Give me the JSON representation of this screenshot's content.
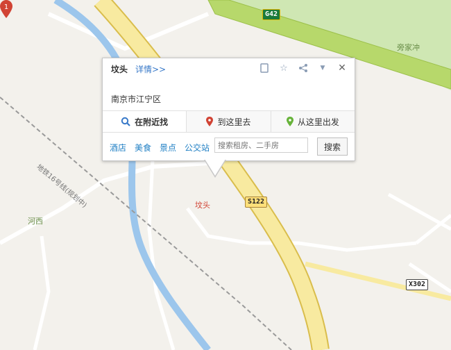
{
  "map": {
    "highways": [
      {
        "code": "G42"
      },
      {
        "code": "S122"
      },
      {
        "code": "X302"
      }
    ],
    "places": [
      "旁家冲",
      "河西",
      "坟头"
    ],
    "metro_label": "地铁16号线(规划中)",
    "marker": {
      "number": "1",
      "label": "坟头"
    }
  },
  "popup": {
    "title": "坟头",
    "detail_link": "详情>>",
    "address": "南京市江宁区",
    "icons": [
      "bookmark-icon",
      "star-icon",
      "share-icon",
      "dropdown-icon",
      "close-icon"
    ],
    "tabs": [
      {
        "label": "在附近找",
        "icon": "search-icon",
        "active": true
      },
      {
        "label": "到这里去",
        "icon": "pin-red-icon",
        "active": false
      },
      {
        "label": "从这里出发",
        "icon": "pin-green-icon",
        "active": false
      }
    ],
    "categories": [
      "酒店",
      "美食",
      "景点",
      "公交站"
    ],
    "search_placeholder": "搜索租房、二手房",
    "search_button": "搜索"
  },
  "colors": {
    "map_bg": "#f3f1ec",
    "green_zone": "#c8e6a9",
    "highway_yellow": "#f5e48a",
    "highway_green": "#b7d86b",
    "river": "#9cc6ec",
    "link_blue": "#3778c8",
    "marker_red": "#d14334"
  }
}
